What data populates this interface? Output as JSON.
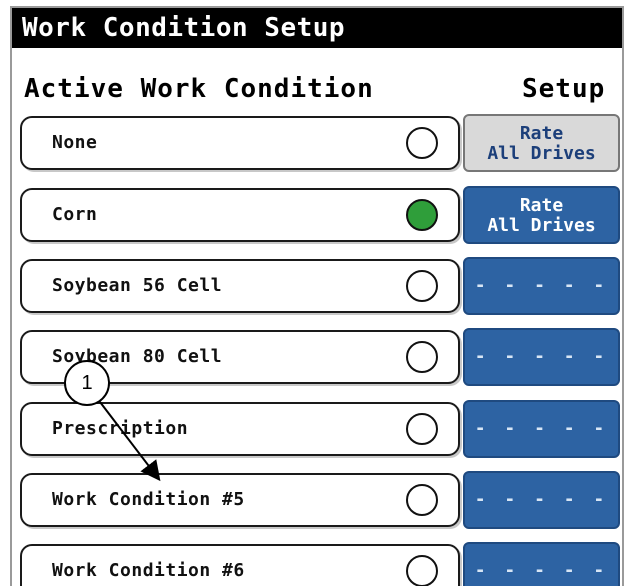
{
  "title": "Work Condition Setup",
  "headers": {
    "active": "Active Work Condition",
    "setup": "Setup"
  },
  "rows": [
    {
      "label": "None",
      "selected": false,
      "setup": {
        "line1": "Rate",
        "line2": "All Drives",
        "style": "gray"
      }
    },
    {
      "label": "Corn",
      "selected": true,
      "setup": {
        "line1": "Rate",
        "line2": "All Drives",
        "style": "blue"
      }
    },
    {
      "label": "Soybean 56 Cell",
      "selected": false,
      "setup": {
        "dashes": "- - - - -",
        "style": "blue"
      }
    },
    {
      "label": "Soybean 80 Cell",
      "selected": false,
      "setup": {
        "dashes": "- - - - -",
        "style": "blue"
      }
    },
    {
      "label": "Prescription",
      "selected": false,
      "setup": {
        "dashes": "- - - - -",
        "style": "blue"
      }
    },
    {
      "label": "Work Condition #5",
      "selected": false,
      "setup": {
        "dashes": "- - - - -",
        "style": "blue"
      }
    },
    {
      "label": "Work Condition #6",
      "selected": false,
      "setup": {
        "dashes": "- - - - -",
        "style": "blue"
      }
    }
  ],
  "callout": {
    "number": "1"
  },
  "colors": {
    "selected_radio": "#2f9e3a",
    "setup_blue": "#2d63a3",
    "setup_gray": "#d9d9d9"
  }
}
